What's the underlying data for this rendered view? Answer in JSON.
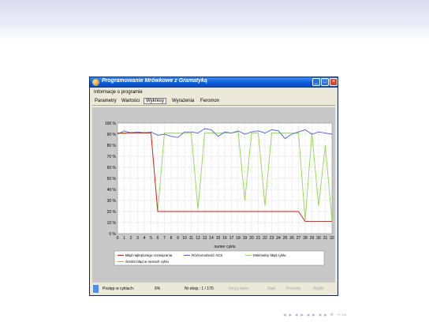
{
  "window": {
    "title": "Programowanie Mrówkowe z Gramatyką",
    "controls": {
      "minimize": "_",
      "maximize": "□",
      "close": "×"
    }
  },
  "menu": {
    "info": "Informacje o programie"
  },
  "tabs": [
    {
      "label": "Parametry",
      "active": false
    },
    {
      "label": "Wartości",
      "active": false
    },
    {
      "label": "Wykresy",
      "active": true
    },
    {
      "label": "Wyrażenia",
      "active": false
    },
    {
      "label": "Feromon",
      "active": false
    }
  ],
  "chart_data": {
    "type": "line",
    "xlabel": "numer cyklu",
    "ylabel": "",
    "x": [
      0,
      1,
      2,
      3,
      4,
      5,
      6,
      7,
      8,
      9,
      10,
      11,
      12,
      13,
      14,
      15,
      16,
      17,
      18,
      19,
      20,
      21,
      22,
      23,
      24,
      25,
      26,
      27,
      28,
      29,
      30,
      31,
      32
    ],
    "y_ticks": [
      "0 %",
      "10 %",
      "20 %",
      "30 %",
      "40 %",
      "50 %",
      "60 %",
      "70 %",
      "80 %",
      "90 %",
      "100 %"
    ],
    "ylim": [
      0,
      100
    ],
    "xlim": [
      0,
      32
    ],
    "grid": true,
    "legend_position": "bottom",
    "series": [
      {
        "name": "Błąd najlepszego rozwiązania",
        "color": "#e01010",
        "values": [
          91,
          91,
          91,
          91,
          91,
          91,
          20,
          20,
          20,
          20,
          20,
          20,
          20,
          20,
          20,
          20,
          20,
          20,
          20,
          20,
          20,
          20,
          20,
          20,
          20,
          20,
          20,
          20,
          11,
          11,
          11,
          11,
          11
        ]
      },
      {
        "name": "Różnorodność ACS",
        "color": "#4b62e0",
        "values": [
          90,
          93,
          91,
          92,
          91,
          92,
          89,
          90,
          88,
          87,
          92,
          92,
          91,
          95,
          94,
          88,
          92,
          91,
          93,
          90,
          92,
          93,
          91,
          94,
          93,
          86,
          90,
          92,
          94,
          90,
          92,
          91,
          90
        ]
      },
      {
        "name": "Minimalny błąd cyklu",
        "color": "#8fd84a",
        "values": [
          91,
          90,
          92,
          91,
          92,
          91,
          20,
          91,
          91,
          91,
          91,
          91,
          22,
          91,
          91,
          91,
          91,
          91,
          92,
          30,
          91,
          91,
          25,
          91,
          91,
          91,
          91,
          91,
          12,
          91,
          25,
          80,
          11
        ]
      },
      {
        "name": "Średni błąd w ramach cyklu",
        "color": "#e09050",
        "values": []
      }
    ]
  },
  "status": {
    "progress_label": "Postęp w cyklach:",
    "progress_value": "6%",
    "experiment": "Nr eksp.: 1 / 170",
    "btn_start": "Inicjuj dane",
    "btn_run": "Start",
    "btn_stop": "Przerwij",
    "btn_exit": "Wyjdź"
  },
  "nav": {
    "symbols": "◂ ▸ ◂ ▸ ◂ ▸ ◂ ▸ ≡ ∽∾"
  },
  "colors": {
    "plot_bg": "#ffffff",
    "chart_frame_bg": "#c8c8c8",
    "title_blue": "#0a5ad8"
  }
}
